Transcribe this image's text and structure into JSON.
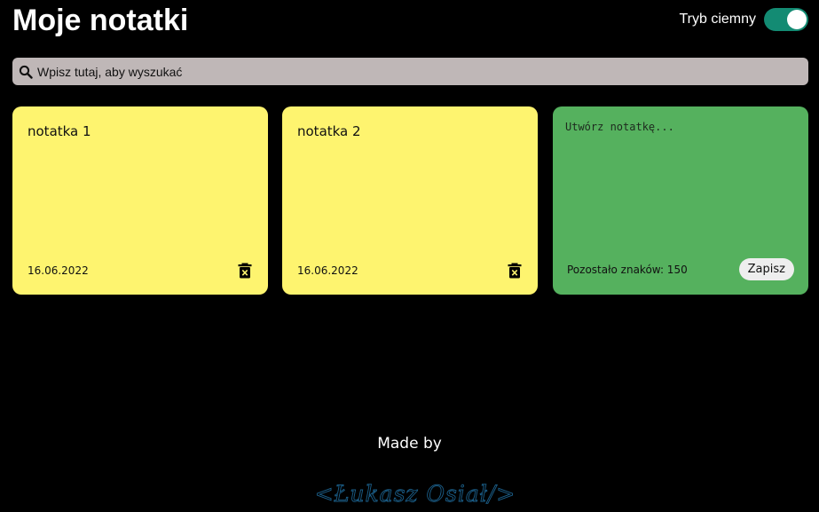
{
  "header": {
    "title": "Moje notatki",
    "dark_mode_label": "Tryb ciemny",
    "dark_mode_on": true
  },
  "search": {
    "placeholder": "Wpisz tutaj, aby wyszukać",
    "value": "",
    "icon": "search-icon"
  },
  "notes": [
    {
      "text": "notatka 1",
      "date": "16.06.2022",
      "delete_icon": "trash-icon"
    },
    {
      "text": "notatka 2",
      "date": "16.06.2022",
      "delete_icon": "trash-icon"
    }
  ],
  "new_note": {
    "placeholder": "Utwórz notatkę...",
    "value": "",
    "chars_remaining": "Pozostało znaków: 150",
    "save_label": "Zapisz"
  },
  "footer": {
    "made_by": "Made by",
    "signature": "<Łukasz Osiał/>"
  },
  "colors": {
    "background": "#000000",
    "note_yellow": "#fef46f",
    "new_note_green": "#55b15e",
    "toggle_on": "#138b73",
    "search_bg": "#bfb7b7",
    "signature": "#1b5f8a"
  }
}
